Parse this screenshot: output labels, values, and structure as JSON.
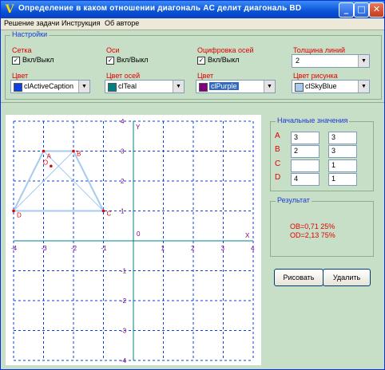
{
  "window": {
    "title": "Определение в каком отношении диагональ AC делит диагональ BD",
    "icon": "app-icon"
  },
  "menu": [
    "Решение задачи",
    "Инструкция",
    "Об авторе"
  ],
  "settings": {
    "title": "Настройки",
    "grid_label": "Сетка",
    "grid_toggle": "Вкл/Выкл",
    "axes_label": "Оси",
    "axes_toggle": "Вкл/Выкл",
    "digits_label": "Оцифровка осей",
    "digits_toggle": "Вкл/Выкл",
    "line_width_label": "Толщина линий",
    "line_width_value": "2",
    "grid_color_label": "Цвет",
    "grid_color_value": "clActiveCaption",
    "axes_color_label": "Цвет осей",
    "axes_color_value": "clTeal",
    "digits_color_label": "Цвет",
    "digits_color_value": "clPurple",
    "figure_color_label": "Цвет рисунка",
    "figure_color_value": "clSkyBlue",
    "colors": {
      "grid": "#0b3fe0",
      "axes": "#008080",
      "digits": "#800080",
      "figure": "#a6caf0"
    }
  },
  "initial": {
    "title": "Начальные значения",
    "rows": [
      {
        "label": "A",
        "x": "3",
        "y": "3"
      },
      {
        "label": "B",
        "x": "2",
        "y": "3"
      },
      {
        "label": "C",
        "x": "",
        "y": "1"
      },
      {
        "label": "D",
        "x": "4",
        "y": "1"
      }
    ]
  },
  "result": {
    "title": "Результат",
    "line1": "OB=0,71  25%",
    "line2": "OD=2,13  75%"
  },
  "buttons": {
    "draw": "Рисовать",
    "clear": "Удалить"
  },
  "chart_data": {
    "type": "scatter",
    "xlim": [
      -4,
      4
    ],
    "ylim": [
      -4,
      4
    ],
    "grid": true,
    "xlabel": "X",
    "ylabel": "Y",
    "origin_label": "0",
    "x_ticks": [
      "-4",
      "-3",
      "-2",
      "-1",
      "1",
      "2",
      "3",
      "4"
    ],
    "y_ticks": [
      "4",
      "3",
      "2",
      "1",
      "-1",
      "-2",
      "-3",
      "-4"
    ],
    "points": [
      {
        "label": "A",
        "x": -3,
        "y": 3
      },
      {
        "label": "B",
        "x": -2,
        "y": 3
      },
      {
        "label": "C",
        "x": -1,
        "y": 1
      },
      {
        "label": "D",
        "x": -4,
        "y": 1
      },
      {
        "label": "O",
        "x": -2.75,
        "y": 2.5
      }
    ],
    "polygon": [
      "A",
      "B",
      "C",
      "D"
    ],
    "diagonals": [
      [
        "A",
        "C"
      ],
      [
        "B",
        "D"
      ]
    ]
  }
}
